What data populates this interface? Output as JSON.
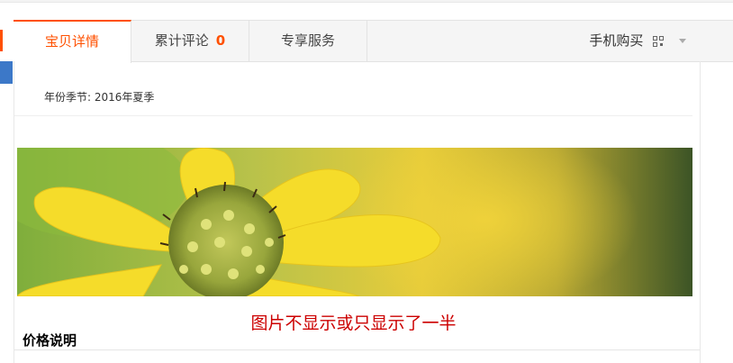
{
  "tabs": [
    {
      "label": "宝贝详情",
      "active": true
    },
    {
      "label": "累计评论",
      "count": "0"
    },
    {
      "label": "专享服务"
    }
  ],
  "mobile_buy": {
    "label": "手机购买",
    "icon": "qr-code-icon"
  },
  "attributes": {
    "season": "年份季节: 2016年夏季"
  },
  "banner": {
    "icon": "flower-photo"
  },
  "caption": "图片不显示或只显示了一半",
  "section_title": "价格说明",
  "colors": {
    "accent": "#ff5000",
    "caption": "#cc0000",
    "left_marker_blue": "#3c78c8"
  }
}
